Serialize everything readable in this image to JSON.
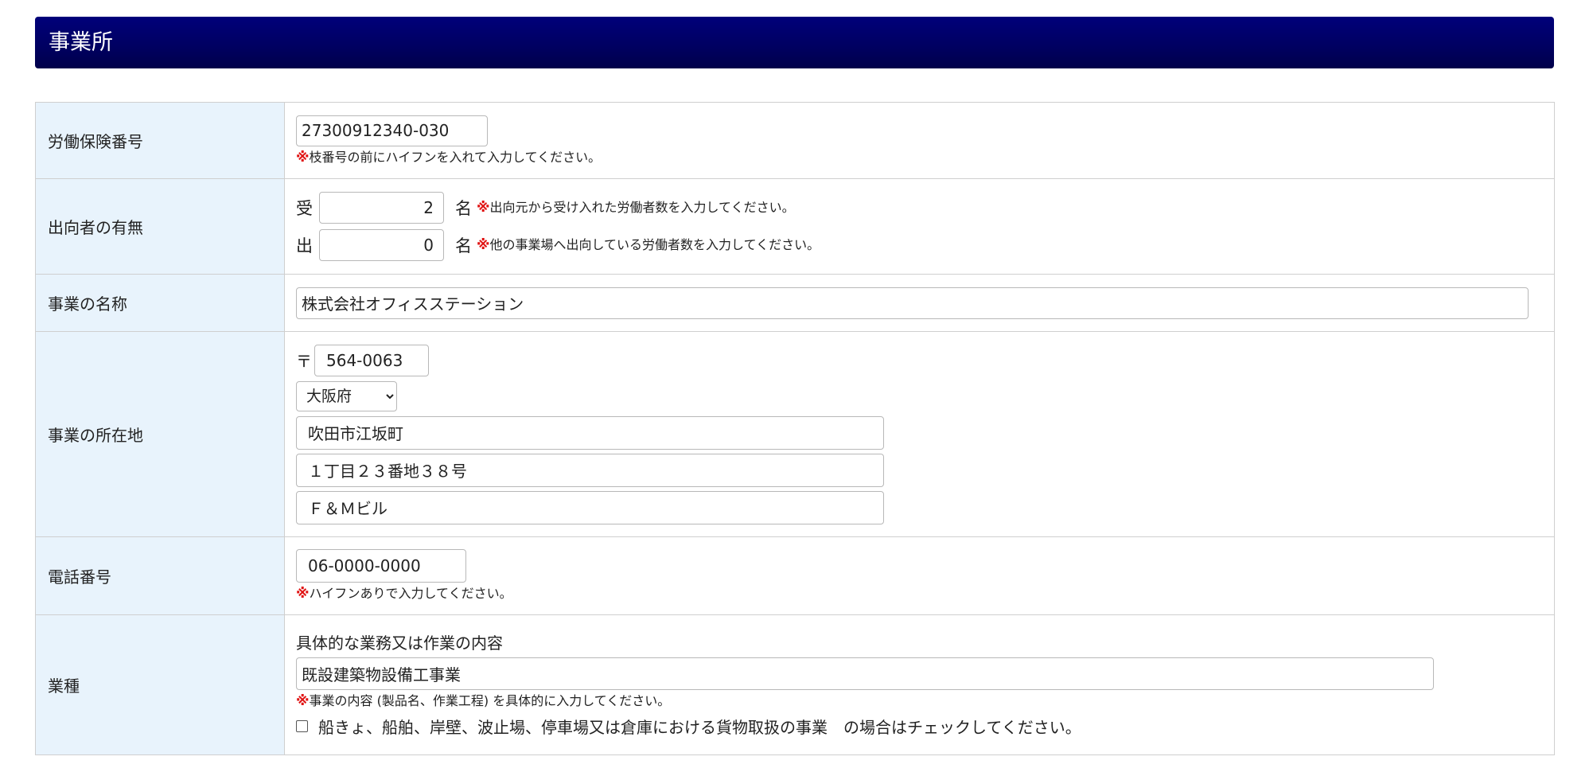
{
  "header": {
    "title": "事業所"
  },
  "rows": {
    "labor_insurance": {
      "label": "労働保険番号",
      "value": "27300912340-030",
      "note_mark": "※",
      "note": "枝番号の前にハイフンを入れて入力してください。"
    },
    "secondment": {
      "label": "出向者の有無",
      "received_prefix": "受",
      "received_value": "2",
      "received_unit": "名",
      "received_note_mark": "※",
      "received_note": "出向元から受け入れた労働者数を入力してください。",
      "sent_prefix": "出",
      "sent_value": "0",
      "sent_unit": "名",
      "sent_note_mark": "※",
      "sent_note": "他の事業場へ出向している労働者数を入力してください。"
    },
    "business_name": {
      "label": "事業の名称",
      "value": "株式会社オフィスステーション"
    },
    "address": {
      "label": "事業の所在地",
      "postal_mark": "〒",
      "postal_code": "564-0063",
      "prefecture": "大阪府",
      "line1": "吹田市江坂町",
      "line2": "１丁目２３番地３８号",
      "line3": "Ｆ＆Ｍビル"
    },
    "phone": {
      "label": "電話番号",
      "value": "06-0000-0000",
      "note_mark": "※",
      "note": "ハイフンありで入力してください。"
    },
    "industry": {
      "label": "業種",
      "content_heading": "具体的な業務又は作業の内容",
      "content_value": "既設建築物設備工事業",
      "note_mark": "※",
      "note": "事業の内容 (製品名、作業工程) を具体的に入力してください。",
      "checkbox_label": "船きょ、船舶、岸壁、波止場、停車場又は倉庫における貨物取扱の事業　の場合はチェックしてください。",
      "checkbox_checked": false
    }
  }
}
